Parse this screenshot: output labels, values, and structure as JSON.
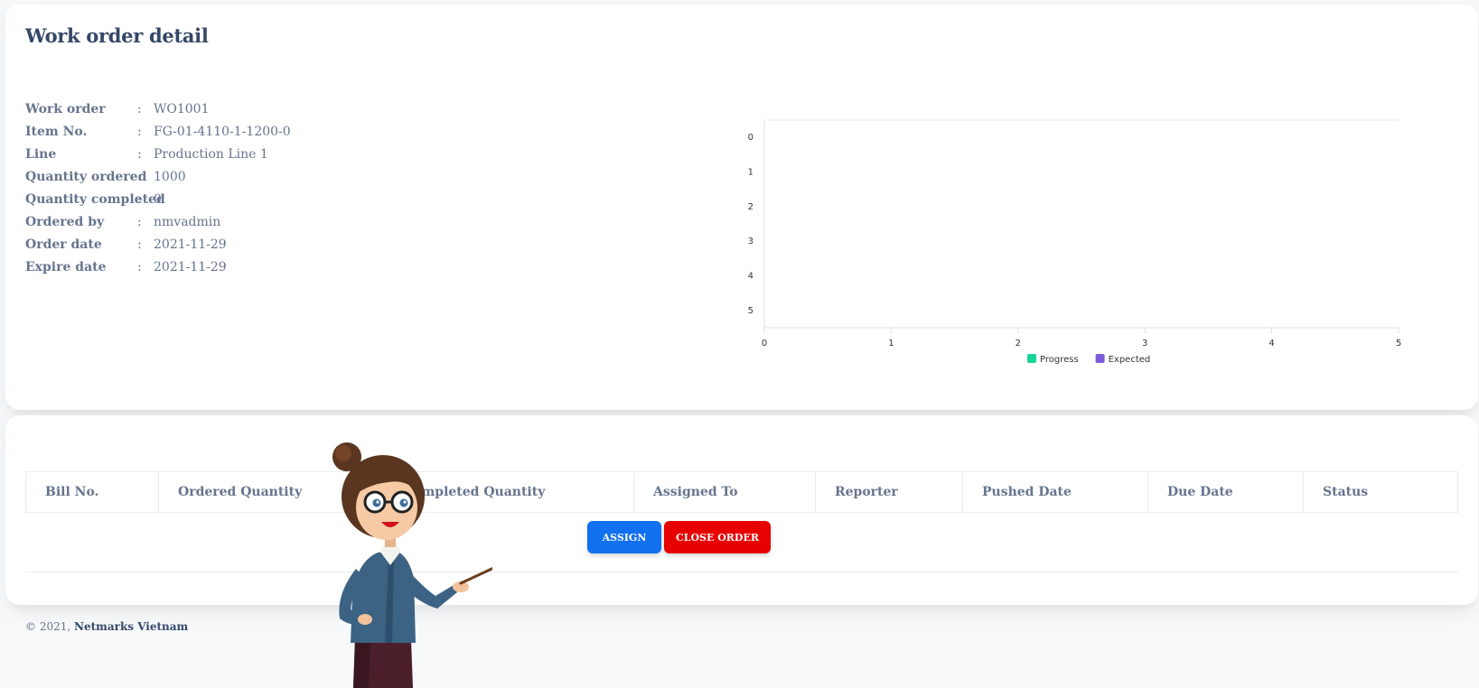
{
  "page": {
    "title": "Work order detail"
  },
  "details": [
    {
      "label": "Work order",
      "value": "WO1001"
    },
    {
      "label": "Item No.",
      "value": "FG-01-4110-1-1200-0"
    },
    {
      "label": "Line",
      "value": "Production Line 1"
    },
    {
      "label": "Quantity ordered",
      "value": "1000"
    },
    {
      "label": "Quantity completed",
      "value": "0"
    },
    {
      "label": "Ordered by",
      "value": "nmvadmin"
    },
    {
      "label": "Order date",
      "value": "2021-11-29"
    },
    {
      "label": "Expire date",
      "value": "2021-11-29"
    }
  ],
  "separator": ":",
  "chart_data": {
    "type": "bar",
    "orientation": "horizontal",
    "categories": [
      "0",
      "1",
      "2",
      "3",
      "4",
      "5"
    ],
    "series": [
      {
        "name": "Progress",
        "color": "#1ad598",
        "values": []
      },
      {
        "name": "Expected",
        "color": "#7a5cdb",
        "values": []
      }
    ],
    "x_ticks": [
      "0",
      "1",
      "2",
      "3",
      "4",
      "5"
    ],
    "xlim": [
      0,
      5
    ],
    "legend_position": "bottom"
  },
  "table": {
    "columns": [
      "Bill No.",
      "Ordered Quantity",
      "Completed Quantity",
      "Assigned To",
      "Reporter",
      "Pushed Date",
      "Due Date",
      "Status"
    ],
    "rows": []
  },
  "actions": {
    "assign": "ASSIGN",
    "close_order": "CLOSE ORDER"
  },
  "footer": {
    "copyright": "© 2021,",
    "company": "Netmarks Vietnam"
  },
  "colors": {
    "assign": "#1171ef",
    "close": "#e60000",
    "text": "#344767",
    "muted": "#67748e"
  },
  "illustration": {
    "icon": "teacher-pointing-icon"
  }
}
